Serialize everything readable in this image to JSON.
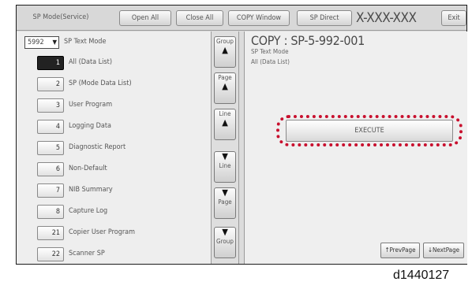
{
  "topbar": {
    "mode_label": "SP Mode(Service)",
    "open_all": "Open All",
    "close_all": "Close All",
    "copy_window": "COPY Window",
    "sp_direct": "SP Direct",
    "code": "X-XXX-XXX",
    "exit": "Exit"
  },
  "left": {
    "code_value": "5992",
    "mode_title": "SP Text Mode",
    "items": [
      {
        "num": "1",
        "label": "All (Data List)"
      },
      {
        "num": "2",
        "label": "SP (Mode Data List)"
      },
      {
        "num": "3",
        "label": "User Program"
      },
      {
        "num": "4",
        "label": "Logging Data"
      },
      {
        "num": "5",
        "label": "Diagnostic Report"
      },
      {
        "num": "6",
        "label": "Non-Default"
      },
      {
        "num": "7",
        "label": "NIB Summary"
      },
      {
        "num": "8",
        "label": "Capture Log"
      },
      {
        "num": "21",
        "label": "Copier User Program"
      },
      {
        "num": "22",
        "label": "Scanner SP"
      }
    ]
  },
  "scroll": {
    "group": "Group",
    "page": "Page",
    "line": "Line",
    "up_arrow": "▲",
    "down_arrow": "▼"
  },
  "right": {
    "title": "COPY : SP-5-992-001",
    "sub1": "SP Text Mode",
    "sub2": "All (Data List)",
    "execute": "EXECUTE",
    "prev_page": "↑PrevPage",
    "next_page": "↓NextPage"
  },
  "caption": "d1440127",
  "colors": {
    "highlight_outline": "#c8102e"
  }
}
